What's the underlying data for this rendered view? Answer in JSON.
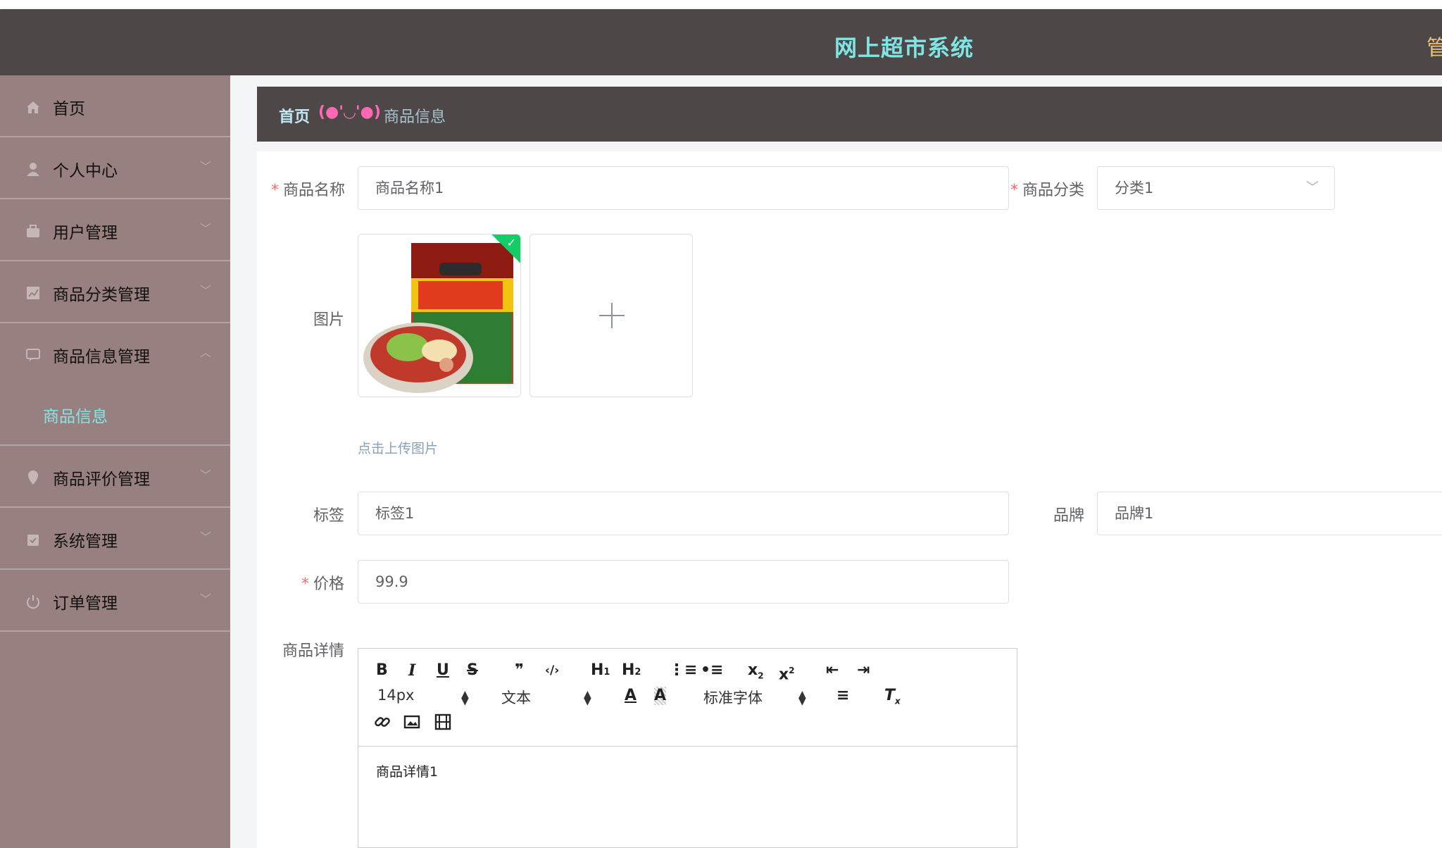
{
  "header": {
    "title": "网上超市系统",
    "admin_text": "管"
  },
  "sidebar": {
    "items": [
      {
        "label": "首页",
        "icon": "home-icon"
      },
      {
        "label": "个人中心",
        "icon": "user-icon"
      },
      {
        "label": "用户管理",
        "icon": "briefcase-icon"
      },
      {
        "label": "商品分类管理",
        "icon": "chart-icon"
      },
      {
        "label": "商品信息管理",
        "icon": "chat-icon"
      },
      {
        "label": "商品评价管理",
        "icon": "location-icon"
      },
      {
        "label": "系统管理",
        "icon": "calendar-check-icon"
      },
      {
        "label": "订单管理",
        "icon": "power-icon"
      }
    ],
    "active_sub": "商品信息"
  },
  "breadcrumb": {
    "home": "首页",
    "separator": "(●'◡'●)",
    "current": "商品信息"
  },
  "form": {
    "name_label": "商品名称",
    "name_value": "商品名称1",
    "category_label": "商品分类",
    "category_value": "分类1",
    "image_label": "图片",
    "upload_tip": "点击上传图片",
    "tag_label": "标签",
    "tag_value": "标签1",
    "brand_label": "品牌",
    "brand_value": "品牌1",
    "price_label": "价格",
    "price_value": "99.9",
    "detail_label": "商品详情"
  },
  "editor": {
    "font_size": "14px",
    "format": "文本",
    "font_family": "标准字体",
    "content": "商品详情1"
  },
  "colors": {
    "header_bg": "#4d4747",
    "sidebar_bg": "#998080",
    "accent": "#7fe6e6",
    "required": "#f56c6c"
  }
}
